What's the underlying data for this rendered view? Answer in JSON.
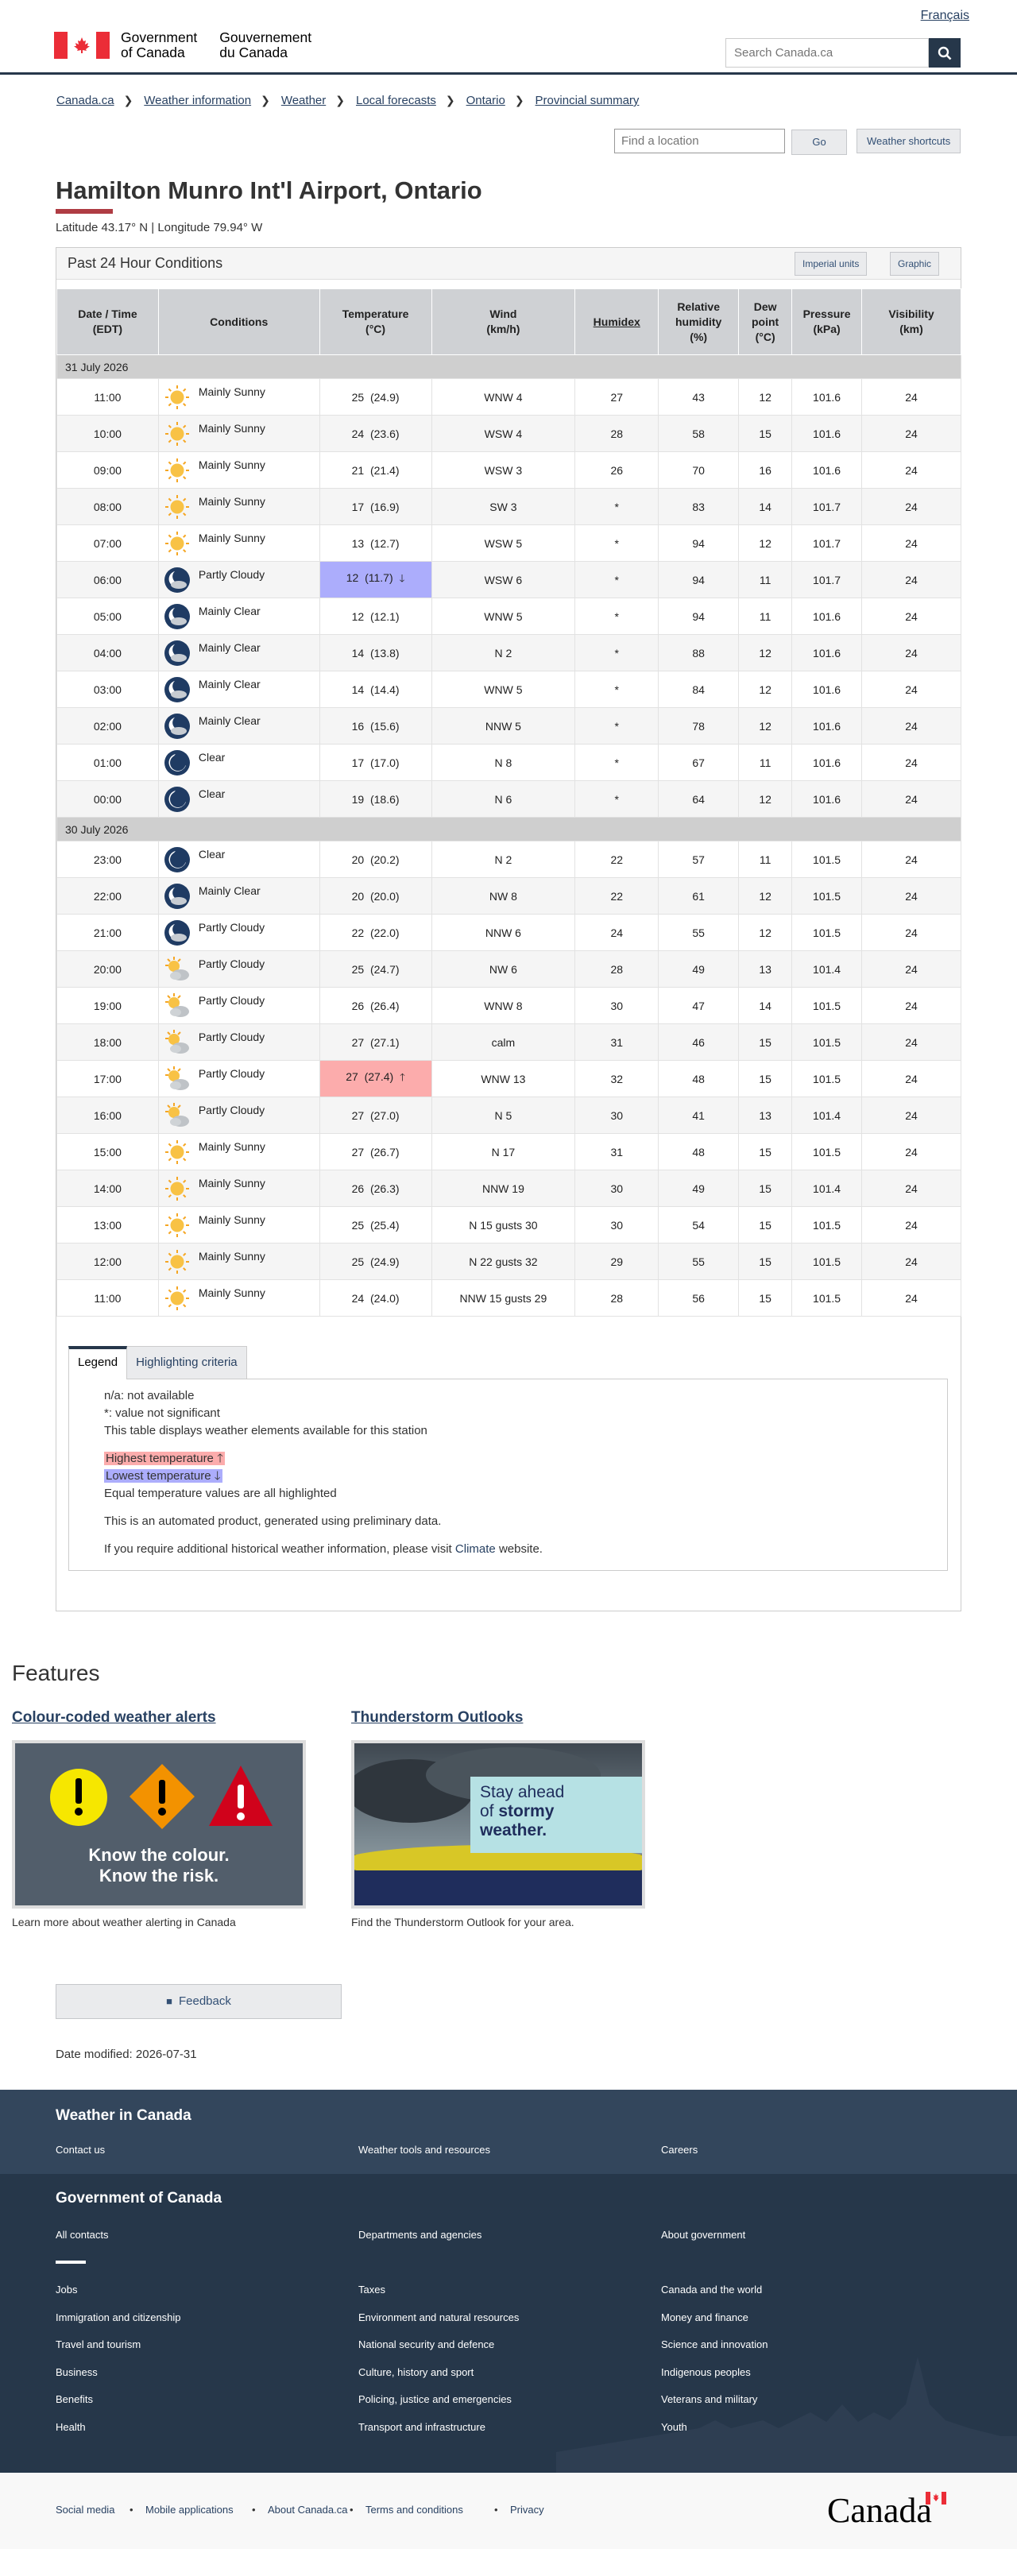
{
  "header": {
    "lang": "Français",
    "gov_en_1": "Government",
    "gov_en_2": "of Canada",
    "gov_fr_1": "Gouvernement",
    "gov_fr_2": "du Canada",
    "search_placeholder": "Search Canada.ca"
  },
  "breadcrumbs": [
    "Canada.ca",
    "Weather information",
    "Weather",
    "Local forecasts",
    "Ontario",
    "Provincial summary"
  ],
  "location": {
    "placeholder": "Find a location",
    "go": "Go",
    "shortcuts": "Weather shortcuts"
  },
  "page": {
    "title": "Hamilton Munro Int'l Airport, Ontario",
    "coords": "Latitude 43.17° N | Longitude 79.94° W"
  },
  "panel": {
    "title": "Past 24 Hour Conditions",
    "imperial": "Imperial units",
    "graphic": "Graphic"
  },
  "table": {
    "headers": {
      "datetime_1": "Date / Time",
      "datetime_2": "(EDT)",
      "conditions": "Conditions",
      "temp_1": "Temperature",
      "temp_2": "(°C)",
      "wind_1": "Wind",
      "wind_2": "(km/h)",
      "humidex": "Humidex",
      "rh_1": "Relative",
      "rh_2": "humidity",
      "rh_3": "(%)",
      "dew_1": "Dew",
      "dew_2": "point",
      "dew_3": "(°C)",
      "pressure_1": "Pressure",
      "pressure_2": "(kPa)",
      "vis_1": "Visibility",
      "vis_2": "(km)"
    },
    "days": [
      {
        "date": "31 July 2026",
        "rows": [
          {
            "time": "11:00",
            "icon": "sun-icon",
            "cond": "Mainly Sunny",
            "temp": "25",
            "temp2": "(24.9)",
            "wind": "WNW 4",
            "humidex": "27",
            "rh": "43",
            "dew": "12",
            "pres": "101.6",
            "vis": "24"
          },
          {
            "time": "10:00",
            "icon": "sun-icon",
            "cond": "Mainly Sunny",
            "temp": "24",
            "temp2": "(23.6)",
            "wind": "WSW 4",
            "humidex": "28",
            "rh": "58",
            "dew": "15",
            "pres": "101.6",
            "vis": "24"
          },
          {
            "time": "09:00",
            "icon": "sun-icon",
            "cond": "Mainly Sunny",
            "temp": "21",
            "temp2": "(21.4)",
            "wind": "WSW 3",
            "humidex": "26",
            "rh": "70",
            "dew": "16",
            "pres": "101.6",
            "vis": "24"
          },
          {
            "time": "08:00",
            "icon": "sun-icon",
            "cond": "Mainly Sunny",
            "temp": "17",
            "temp2": "(16.9)",
            "wind": "SW 3",
            "humidex": "*",
            "rh": "83",
            "dew": "14",
            "pres": "101.7",
            "vis": "24"
          },
          {
            "time": "07:00",
            "icon": "sun-icon",
            "cond": "Mainly Sunny",
            "temp": "13",
            "temp2": "(12.7)",
            "wind": "WSW 5",
            "humidex": "*",
            "rh": "94",
            "dew": "12",
            "pres": "101.7",
            "vis": "24"
          },
          {
            "time": "06:00",
            "icon": "night-cloud-icon",
            "cond": "Partly Cloudy",
            "temp": "12",
            "temp2": "(11.7)",
            "wind": "WSW 6",
            "humidex": "*",
            "rh": "94",
            "dew": "11",
            "pres": "101.7",
            "vis": "24",
            "hl": "low"
          },
          {
            "time": "05:00",
            "icon": "night-cloud-icon",
            "cond": "Mainly Clear",
            "temp": "12",
            "temp2": "(12.1)",
            "wind": "WNW 5",
            "humidex": "*",
            "rh": "94",
            "dew": "11",
            "pres": "101.6",
            "vis": "24"
          },
          {
            "time": "04:00",
            "icon": "night-cloud-icon",
            "cond": "Mainly Clear",
            "temp": "14",
            "temp2": "(13.8)",
            "wind": "N 2",
            "humidex": "*",
            "rh": "88",
            "dew": "12",
            "pres": "101.6",
            "vis": "24"
          },
          {
            "time": "03:00",
            "icon": "night-cloud-icon",
            "cond": "Mainly Clear",
            "temp": "14",
            "temp2": "(14.4)",
            "wind": "WNW 5",
            "humidex": "*",
            "rh": "84",
            "dew": "12",
            "pres": "101.6",
            "vis": "24"
          },
          {
            "time": "02:00",
            "icon": "night-cloud-icon",
            "cond": "Mainly Clear",
            "temp": "16",
            "temp2": "(15.6)",
            "wind": "NNW 5",
            "humidex": "*",
            "rh": "78",
            "dew": "12",
            "pres": "101.6",
            "vis": "24"
          },
          {
            "time": "01:00",
            "icon": "moon-icon",
            "cond": "Clear",
            "temp": "17",
            "temp2": "(17.0)",
            "wind": "N 8",
            "humidex": "*",
            "rh": "67",
            "dew": "11",
            "pres": "101.6",
            "vis": "24"
          },
          {
            "time": "00:00",
            "icon": "moon-icon",
            "cond": "Clear",
            "temp": "19",
            "temp2": "(18.6)",
            "wind": "N 6",
            "humidex": "*",
            "rh": "64",
            "dew": "12",
            "pres": "101.6",
            "vis": "24"
          }
        ]
      },
      {
        "date": "30 July 2026",
        "rows": [
          {
            "time": "23:00",
            "icon": "moon-icon",
            "cond": "Clear",
            "temp": "20",
            "temp2": "(20.2)",
            "wind": "N 2",
            "humidex": "22",
            "rh": "57",
            "dew": "11",
            "pres": "101.5",
            "vis": "24"
          },
          {
            "time": "22:00",
            "icon": "night-cloud-icon",
            "cond": "Mainly Clear",
            "temp": "20",
            "temp2": "(20.0)",
            "wind": "NW 8",
            "humidex": "22",
            "rh": "61",
            "dew": "12",
            "pres": "101.5",
            "vis": "24"
          },
          {
            "time": "21:00",
            "icon": "night-cloud-icon",
            "cond": "Partly Cloudy",
            "temp": "22",
            "temp2": "(22.0)",
            "wind": "NNW 6",
            "humidex": "24",
            "rh": "55",
            "dew": "12",
            "pres": "101.5",
            "vis": "24"
          },
          {
            "time": "20:00",
            "icon": "sun-cloud-icon",
            "cond": "Partly Cloudy",
            "temp": "25",
            "temp2": "(24.7)",
            "wind": "NW 6",
            "humidex": "28",
            "rh": "49",
            "dew": "13",
            "pres": "101.4",
            "vis": "24"
          },
          {
            "time": "19:00",
            "icon": "sun-cloud-icon",
            "cond": "Partly Cloudy",
            "temp": "26",
            "temp2": "(26.4)",
            "wind": "WNW 8",
            "humidex": "30",
            "rh": "47",
            "dew": "14",
            "pres": "101.5",
            "vis": "24"
          },
          {
            "time": "18:00",
            "icon": "sun-cloud-icon",
            "cond": "Partly Cloudy",
            "temp": "27",
            "temp2": "(27.1)",
            "wind": "calm",
            "humidex": "31",
            "rh": "46",
            "dew": "15",
            "pres": "101.5",
            "vis": "24"
          },
          {
            "time": "17:00",
            "icon": "sun-cloud-icon",
            "cond": "Partly Cloudy",
            "temp": "27",
            "temp2": "(27.4)",
            "wind": "WNW 13",
            "humidex": "32",
            "rh": "48",
            "dew": "15",
            "pres": "101.5",
            "vis": "24",
            "hl": "high"
          },
          {
            "time": "16:00",
            "icon": "sun-cloud-icon",
            "cond": "Partly Cloudy",
            "temp": "27",
            "temp2": "(27.0)",
            "wind": "N 5",
            "humidex": "30",
            "rh": "41",
            "dew": "13",
            "pres": "101.4",
            "vis": "24"
          },
          {
            "time": "15:00",
            "icon": "sun-icon",
            "cond": "Mainly Sunny",
            "temp": "27",
            "temp2": "(26.7)",
            "wind": "N 17",
            "humidex": "31",
            "rh": "48",
            "dew": "15",
            "pres": "101.5",
            "vis": "24"
          },
          {
            "time": "14:00",
            "icon": "sun-icon",
            "cond": "Mainly Sunny",
            "temp": "26",
            "temp2": "(26.3)",
            "wind": "NNW 19",
            "humidex": "30",
            "rh": "49",
            "dew": "15",
            "pres": "101.4",
            "vis": "24"
          },
          {
            "time": "13:00",
            "icon": "sun-icon",
            "cond": "Mainly Sunny",
            "temp": "25",
            "temp2": "(25.4)",
            "wind": "N 15 gusts 30",
            "humidex": "30",
            "rh": "54",
            "dew": "15",
            "pres": "101.5",
            "vis": "24"
          },
          {
            "time": "12:00",
            "icon": "sun-icon",
            "cond": "Mainly Sunny",
            "temp": "25",
            "temp2": "(24.9)",
            "wind": "N 22 gusts 32",
            "humidex": "29",
            "rh": "55",
            "dew": "15",
            "pres": "101.5",
            "vis": "24"
          },
          {
            "time": "11:00",
            "icon": "sun-icon",
            "cond": "Mainly Sunny",
            "temp": "24",
            "temp2": "(24.0)",
            "wind": "NNW 15 gusts 29",
            "humidex": "28",
            "rh": "56",
            "dew": "15",
            "pres": "101.5",
            "vis": "24"
          }
        ]
      }
    ]
  },
  "legend": {
    "tab_legend": "Legend",
    "tab_criteria": "Highlighting criteria",
    "na": "n/a: not available",
    "star": "*: value not significant",
    "elements": "This table displays weather elements available for this station",
    "highest": "Highest temperature",
    "lowest": "Lowest temperature",
    "equal": "Equal temperature values are all highlighted",
    "automated": "This is an automated product, generated using preliminary data.",
    "historical_pre": "If you require additional historical weather information, please visit",
    "historical_link": "Climate",
    "historical_post": "website."
  },
  "features": {
    "heading": "Features",
    "alerts_title": "Colour-coded weather alerts",
    "alerts_img_1": "Know the colour.",
    "alerts_img_2": "Know the risk.",
    "alerts_caption": "Learn more about weather alerting in Canada",
    "storm_title": "Thunderstorm Outlooks",
    "storm_img_1": "Stay ahead",
    "storm_img_2": "of",
    "storm_img_3": "stormy",
    "storm_img_4": "weather.",
    "storm_caption": "Find the Thunderstorm Outlook for your area."
  },
  "feedback": "Feedback",
  "date_modified": "Date modified: 2026-07-31",
  "footer": {
    "weather_title": "Weather in Canada",
    "weather_links": [
      "Contact us",
      "Weather tools and resources",
      "Careers"
    ],
    "gov_title": "Government of Canada",
    "gov_top": [
      "All contacts",
      "Departments and agencies",
      "About government"
    ],
    "gov_col1": [
      "Jobs",
      "Immigration and citizenship",
      "Travel and tourism",
      "Business",
      "Benefits",
      "Health"
    ],
    "gov_col2": [
      "Taxes",
      "Environment and natural resources",
      "National security and defence",
      "Culture, history and sport",
      "Policing, justice and emergencies",
      "Transport and infrastructure"
    ],
    "gov_col3": [
      "Canada and the world",
      "Money and finance",
      "Science and innovation",
      "Indigenous peoples",
      "Veterans and military",
      "Youth"
    ],
    "bottom_links": [
      "Social media",
      "Mobile applications",
      "About Canada.ca",
      "Terms and conditions",
      "Privacy"
    ],
    "wordmark": "Canada"
  },
  "colors": {
    "brand_navy": "#26374a",
    "accent_red": "#af3c43",
    "highest_temp": "#fcacac",
    "lowest_temp": "#acadfc"
  }
}
